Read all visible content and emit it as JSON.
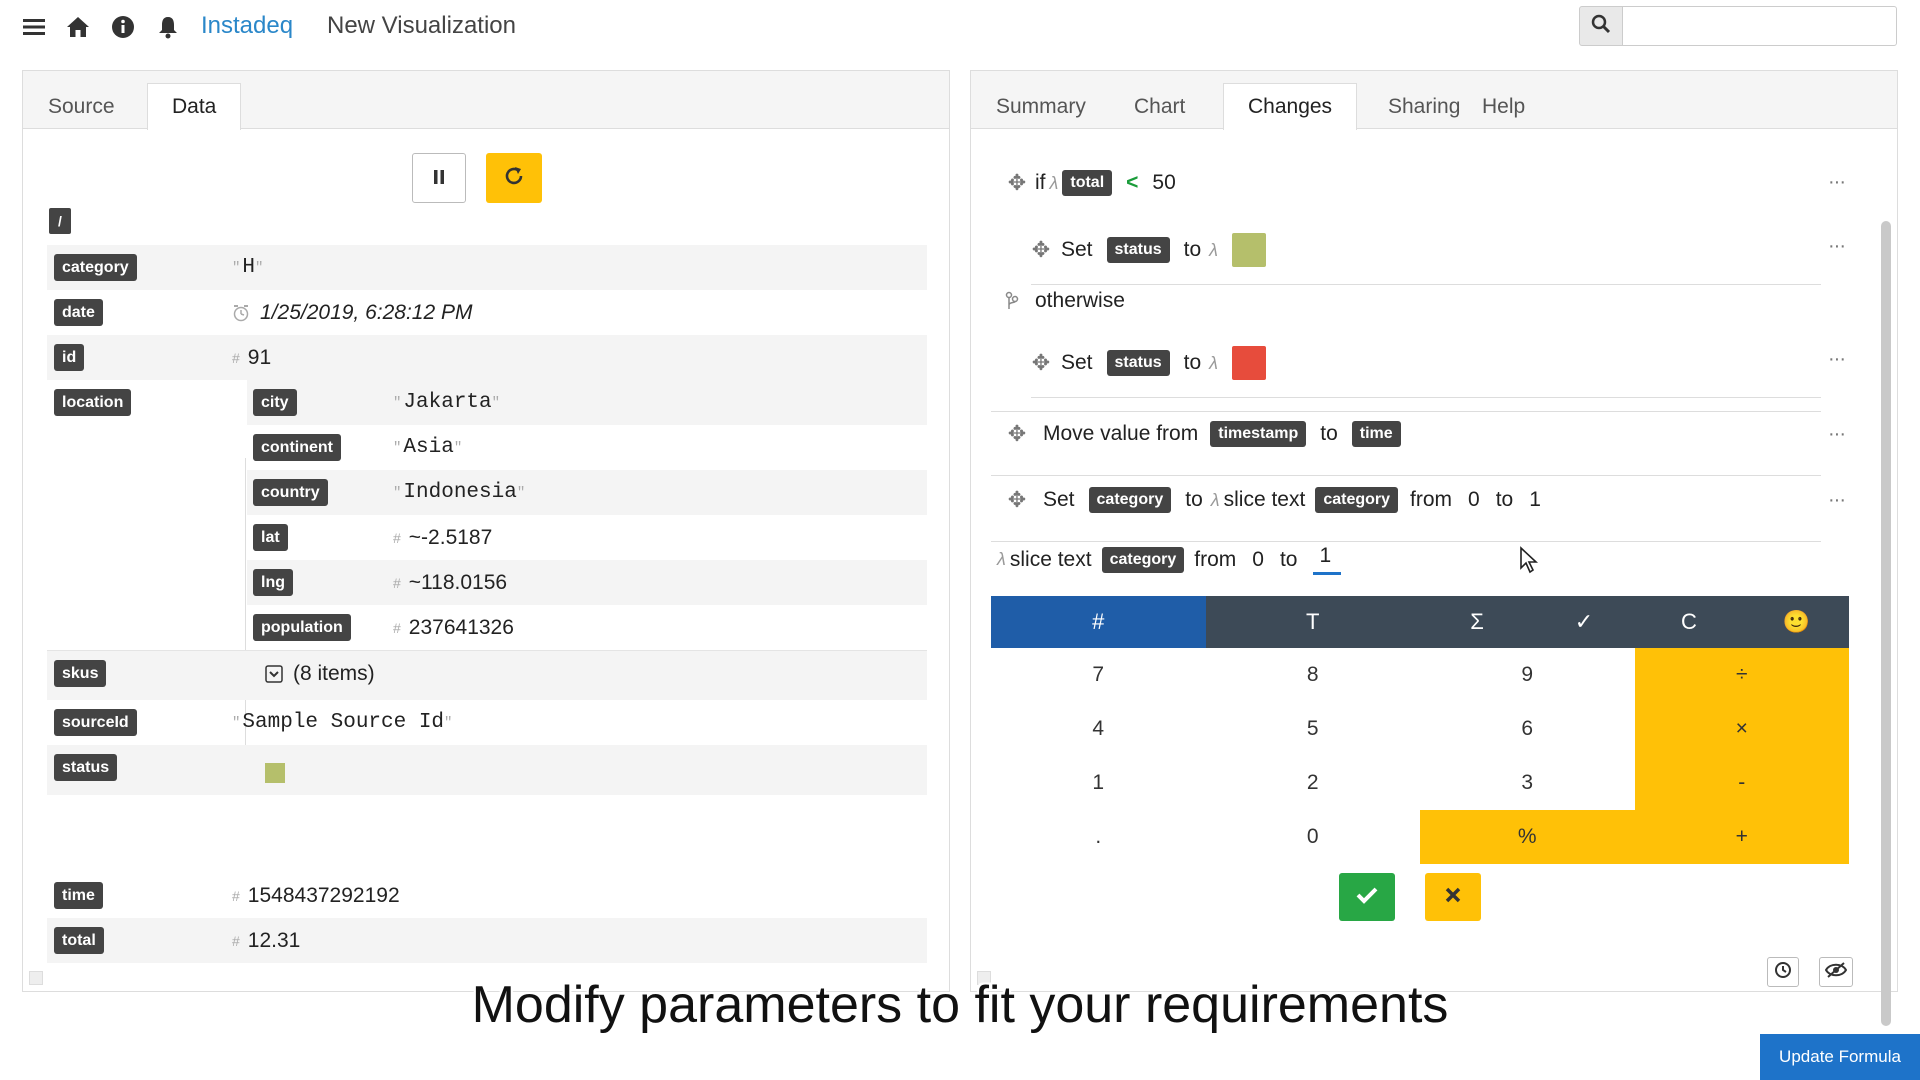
{
  "header": {
    "app_name": "Instadeq",
    "title": "New Visualization",
    "search": {
      "value": "",
      "placeholder": ""
    }
  },
  "left_panel": {
    "tabs": [
      {
        "label": "Source"
      },
      {
        "label": "Data",
        "active": true
      }
    ],
    "root_label": "/",
    "fields": {
      "category": {
        "key": "category",
        "value": "H"
      },
      "date": {
        "key": "date",
        "value": "1/25/2019, 6:28:12 PM"
      },
      "id": {
        "key": "id",
        "value": "91"
      },
      "location": {
        "key": "location",
        "city": {
          "key": "city",
          "value": "Jakarta"
        },
        "continent": {
          "key": "continent",
          "value": "Asia"
        },
        "country": {
          "key": "country",
          "value": "Indonesia"
        },
        "lat": {
          "key": "lat",
          "value": "~-2.5187"
        },
        "lng": {
          "key": "lng",
          "value": "~118.0156"
        },
        "population": {
          "key": "population",
          "value": "237641326"
        }
      },
      "skus": {
        "key": "skus",
        "value": "(8 items)"
      },
      "sourceId": {
        "key": "sourceId",
        "value": "Sample Source Id"
      },
      "status": {
        "key": "status",
        "color": "#b5bf6b"
      },
      "time": {
        "key": "time",
        "value": "1548437292192"
      },
      "total": {
        "key": "total",
        "value": "12.31"
      }
    }
  },
  "right_panel": {
    "tabs": [
      {
        "label": "Summary"
      },
      {
        "label": "Chart"
      },
      {
        "label": "Changes",
        "active": true
      },
      {
        "label": "Sharing"
      },
      {
        "label": "Help"
      }
    ],
    "rules": {
      "if_word": "if",
      "if_field": "total",
      "if_op": "<",
      "if_value": "50",
      "set_word": "Set",
      "to_word": "to",
      "status_field": "status",
      "then_color": "#b5bf6b",
      "otherwise": "otherwise",
      "else_color": "#e74c3c",
      "move_label": "Move value from",
      "move_from": "timestamp",
      "move_to": "time",
      "set_category_field": "category",
      "slice_label": "slice text",
      "slice_field": "category",
      "from_word": "from",
      "slice_from": "0",
      "slice_to": "1",
      "more": "···"
    },
    "editor": {
      "slice_label": "slice text",
      "slice_field": "category",
      "from_word": "from",
      "from_value": "0",
      "to_word": "to",
      "to_value": "1"
    },
    "calculator": {
      "tabs": [
        "#",
        "T",
        "Σ",
        "✓",
        "C",
        "🙂"
      ],
      "active_tab": "#",
      "rows": [
        [
          "7",
          "8",
          "9",
          "÷"
        ],
        [
          "4",
          "5",
          "6",
          "×"
        ],
        [
          "1",
          "2",
          "3",
          "-"
        ],
        [
          ".",
          "0",
          "%",
          "+"
        ]
      ]
    }
  },
  "caption": "Modify parameters to fit your requirements",
  "footer": {
    "update_button": "Update Formula"
  }
}
